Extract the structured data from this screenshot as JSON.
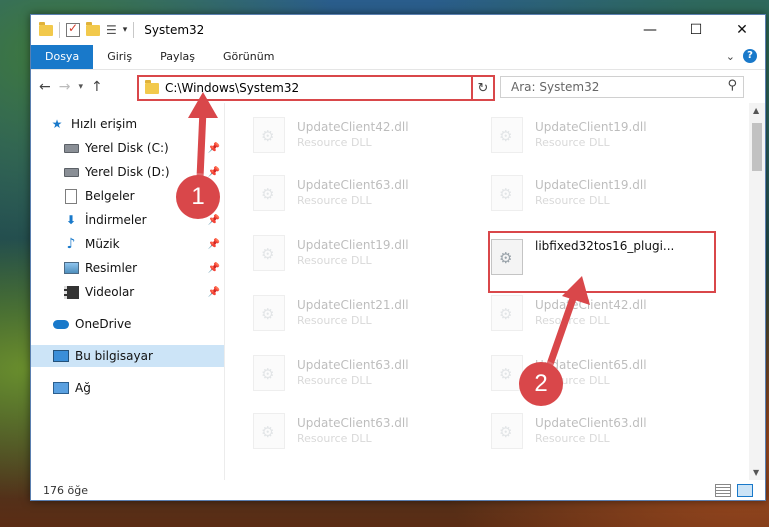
{
  "window": {
    "title": "System32",
    "controls": {
      "minimize": "—",
      "maximize": "☐",
      "close": "✕"
    }
  },
  "ribbon": {
    "tabs": [
      "Dosya",
      "Giriş",
      "Paylaş",
      "Görünüm"
    ],
    "help": "?"
  },
  "address_bar": {
    "path": "C:\\Windows\\System32",
    "search_placeholder": "Ara: System32"
  },
  "sidebar": {
    "items": [
      {
        "label": "Hızlı erişim",
        "icon": "star-icon"
      },
      {
        "label": "Yerel Disk (C:)",
        "icon": "drive-icon"
      },
      {
        "label": "Yerel Disk (D:)",
        "icon": "drive-icon"
      },
      {
        "label": "Belgeler",
        "icon": "documents-icon"
      },
      {
        "label": "İndirmeler",
        "icon": "downloads-icon"
      },
      {
        "label": "Müzik",
        "icon": "music-icon"
      },
      {
        "label": "Resimler",
        "icon": "pictures-icon"
      },
      {
        "label": "Videolar",
        "icon": "videos-icon"
      },
      {
        "label": "OneDrive",
        "icon": "onedrive-icon"
      },
      {
        "label": "Bu bilgisayar",
        "icon": "this-pc-icon",
        "selected": true
      },
      {
        "label": "Ağ",
        "icon": "network-icon"
      }
    ]
  },
  "files": {
    "left_column": [
      {
        "name": "UpdateClient42.dll",
        "desc": "Resource DLL"
      },
      {
        "name": "UpdateClient63.dll",
        "desc": "Resource DLL"
      },
      {
        "name": "UpdateClient19.dll",
        "desc": "Resource DLL"
      },
      {
        "name": "UpdateClient21.dll",
        "desc": "Resource DLL"
      },
      {
        "name": "UpdateClient63.dll",
        "desc": "Resource DLL"
      },
      {
        "name": "UpdateClient63.dll",
        "desc": "Resource DLL"
      }
    ],
    "right_column": [
      {
        "name": "UpdateClient19.dll",
        "desc": "Resource DLL"
      },
      {
        "name": "UpdateClient19.dll",
        "desc": "Resource DLL"
      },
      {
        "name": "libfixed32tos16_plugi...",
        "desc": "",
        "highlighted": true
      },
      {
        "name": "UpdateClient42.dll",
        "desc": "Resource DLL"
      },
      {
        "name": "UpdateClient65.dll",
        "desc": "Resource DLL"
      },
      {
        "name": "UpdateClient63.dll",
        "desc": "Resource DLL"
      }
    ]
  },
  "status": {
    "count": "176 öğe"
  },
  "annotations": {
    "step1": "1",
    "step2": "2"
  },
  "colors": {
    "accent": "#1979ca",
    "annotation": "#d9474a"
  }
}
